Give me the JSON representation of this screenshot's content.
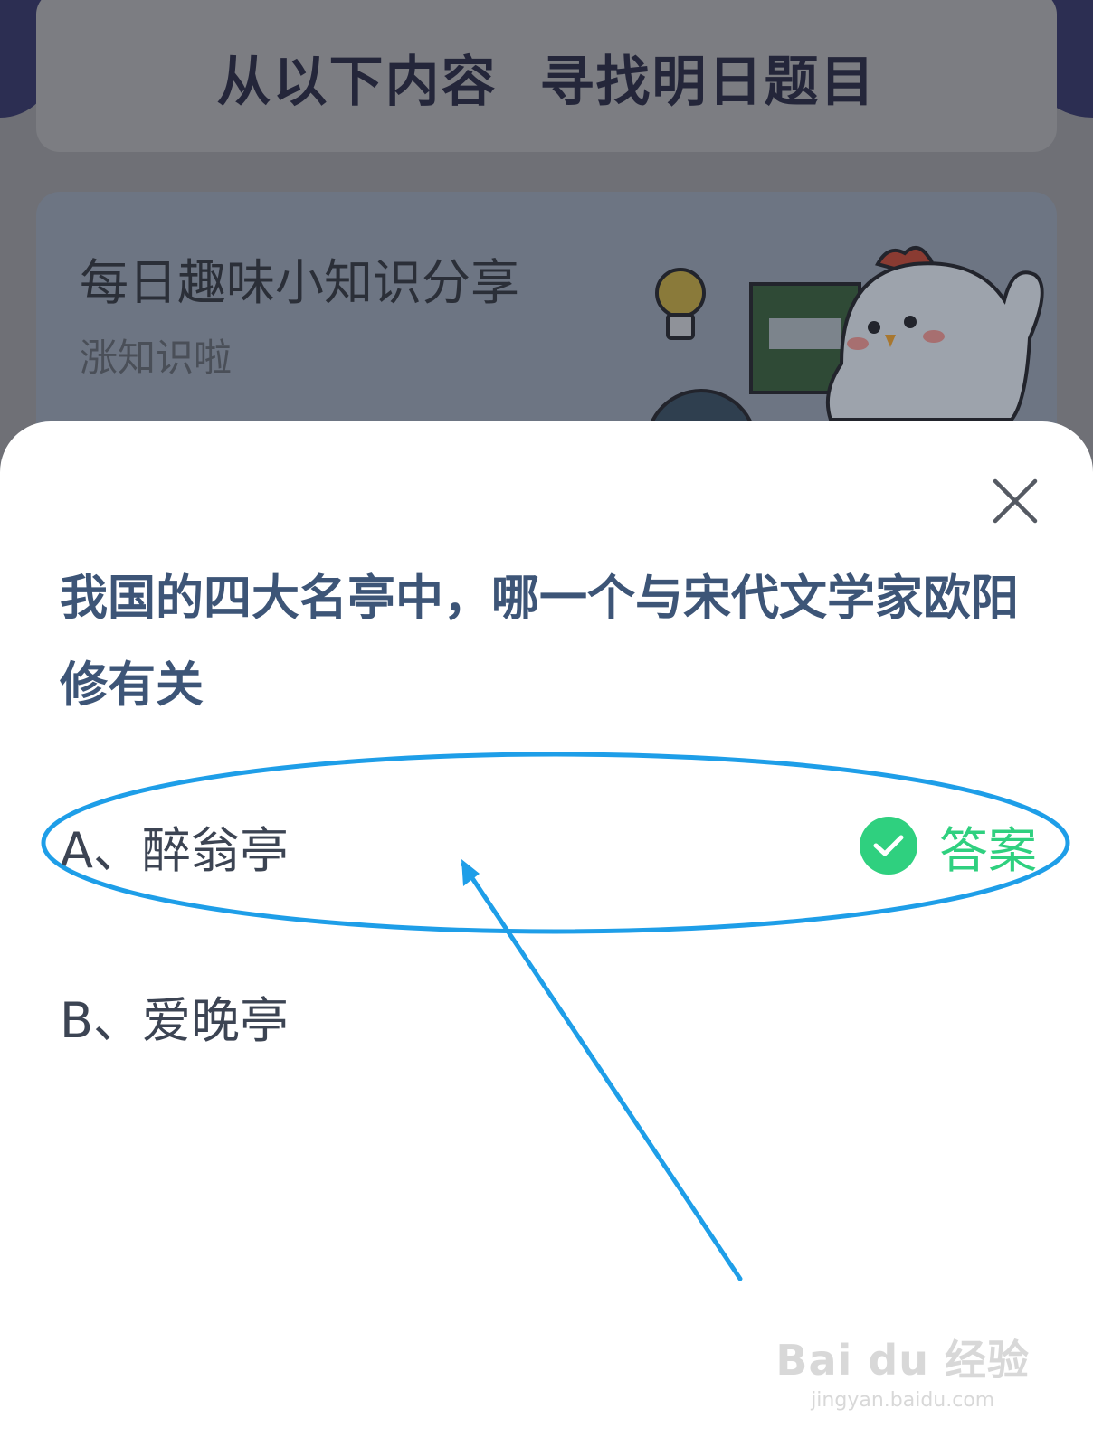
{
  "background": {
    "banner_title_part1": "从以下内容",
    "banner_title_part2": "寻找明日题目",
    "card_title": "每日趣味小知识分享",
    "card_subtitle": "涨知识啦"
  },
  "sheet": {
    "question": "我国的四大名亭中，哪一个与宋代文学家欧阳修有关",
    "options": [
      {
        "label": "A、醉翁亭",
        "answer_label": "答案"
      },
      {
        "label": "B、爱晚亭"
      }
    ]
  },
  "colors": {
    "question_text": "#3d5577",
    "answer_green": "#2fd07f",
    "annotation_blue": "#1e9ee8"
  },
  "watermark": {
    "logo": "Bai du 经验",
    "url": "jingyan.baidu.com"
  }
}
